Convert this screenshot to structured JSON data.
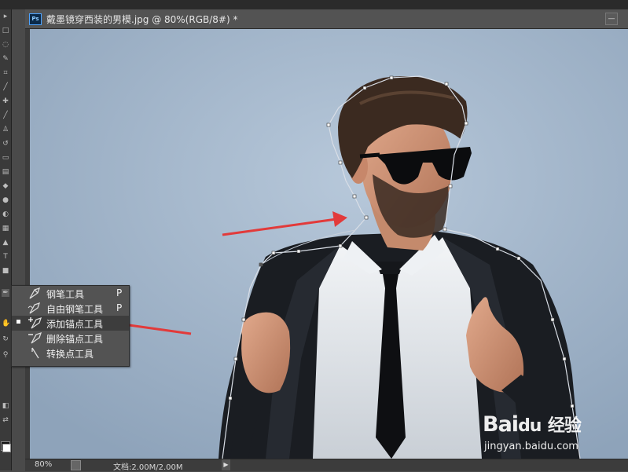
{
  "document": {
    "badge": "Ps",
    "title": "戴墨镜穿西装的男模.jpg @ 80%(RGB/8#) *",
    "minimize_symbol": "—",
    "close_symbol": "×"
  },
  "statusbar": {
    "zoom": "80%",
    "doc_size": "文档:2.00M/2.00M",
    "menu_arrow": "▶"
  },
  "tool_flyout": {
    "items": [
      {
        "label": "钢笔工具",
        "shortcut": "P",
        "icon": "pen-icon"
      },
      {
        "label": "自由钢笔工具",
        "shortcut": "P",
        "icon": "freeform-pen-icon"
      },
      {
        "label": "添加锚点工具",
        "shortcut": "",
        "icon": "add-anchor-icon",
        "selected": true
      },
      {
        "label": "删除锚点工具",
        "shortcut": "",
        "icon": "delete-anchor-icon"
      },
      {
        "label": "转换点工具",
        "shortcut": "",
        "icon": "convert-point-icon"
      }
    ]
  },
  "watermark": {
    "logo": "Bai",
    "logo_paw": "du",
    "site": "经验",
    "url": "jingyan.baidu.com"
  },
  "colors": {
    "canvas_bg": "#a6b8cc",
    "annotation_red": "#e23a3a",
    "path_line": "#cfd6df"
  }
}
